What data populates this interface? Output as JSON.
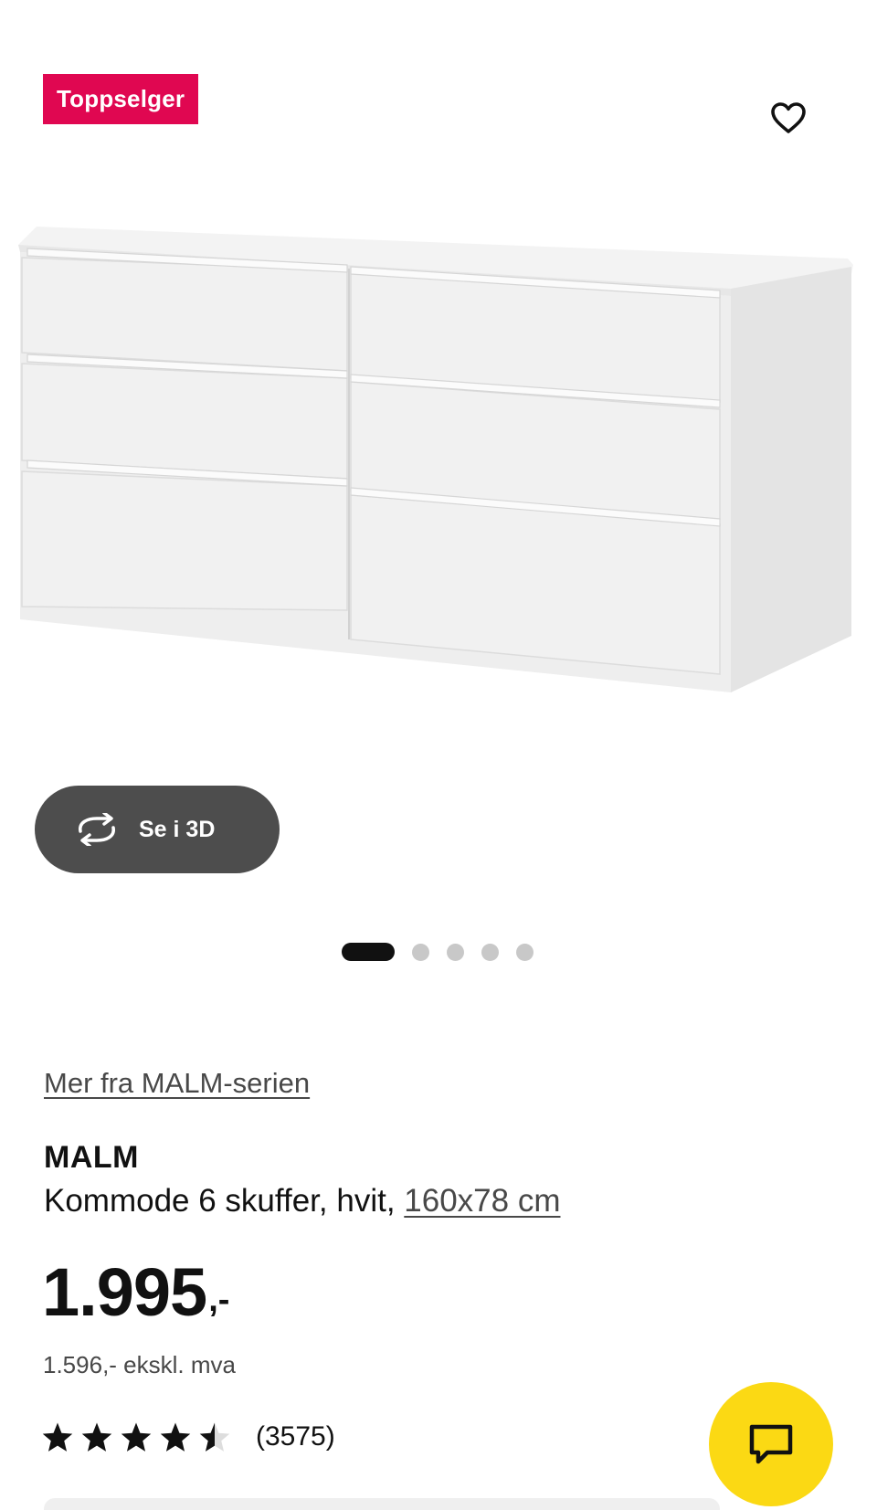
{
  "colors": {
    "badge_bg": "#e00751",
    "chat_button_bg": "#fbd914",
    "view3d_button_bg": "#4d4d4d",
    "active_dot": "#111111",
    "inactive_dot": "#c8c8c8"
  },
  "hero": {
    "badge": "Toppselger",
    "favorite_icon": "heart-outline-icon",
    "image_subject": "white 6-drawer chest",
    "view3d": {
      "icon": "rotate-arrows-icon",
      "label": "Se i 3D"
    },
    "carousel": {
      "total": 5,
      "active_index": 0
    }
  },
  "product": {
    "series_link": "Mer fra MALM-serien",
    "name": "MALM",
    "description": "Kommode 6 skuffer, hvit,",
    "size_link": "160x78 cm",
    "price": {
      "main": "1.995",
      "suffix": ",-"
    },
    "price_ex_vat": "1.596,- ekskl. mva",
    "rating": {
      "value": 4.5,
      "max": 5,
      "count": "(3575)"
    }
  },
  "chat": {
    "icon": "chat-bubble-icon"
  }
}
